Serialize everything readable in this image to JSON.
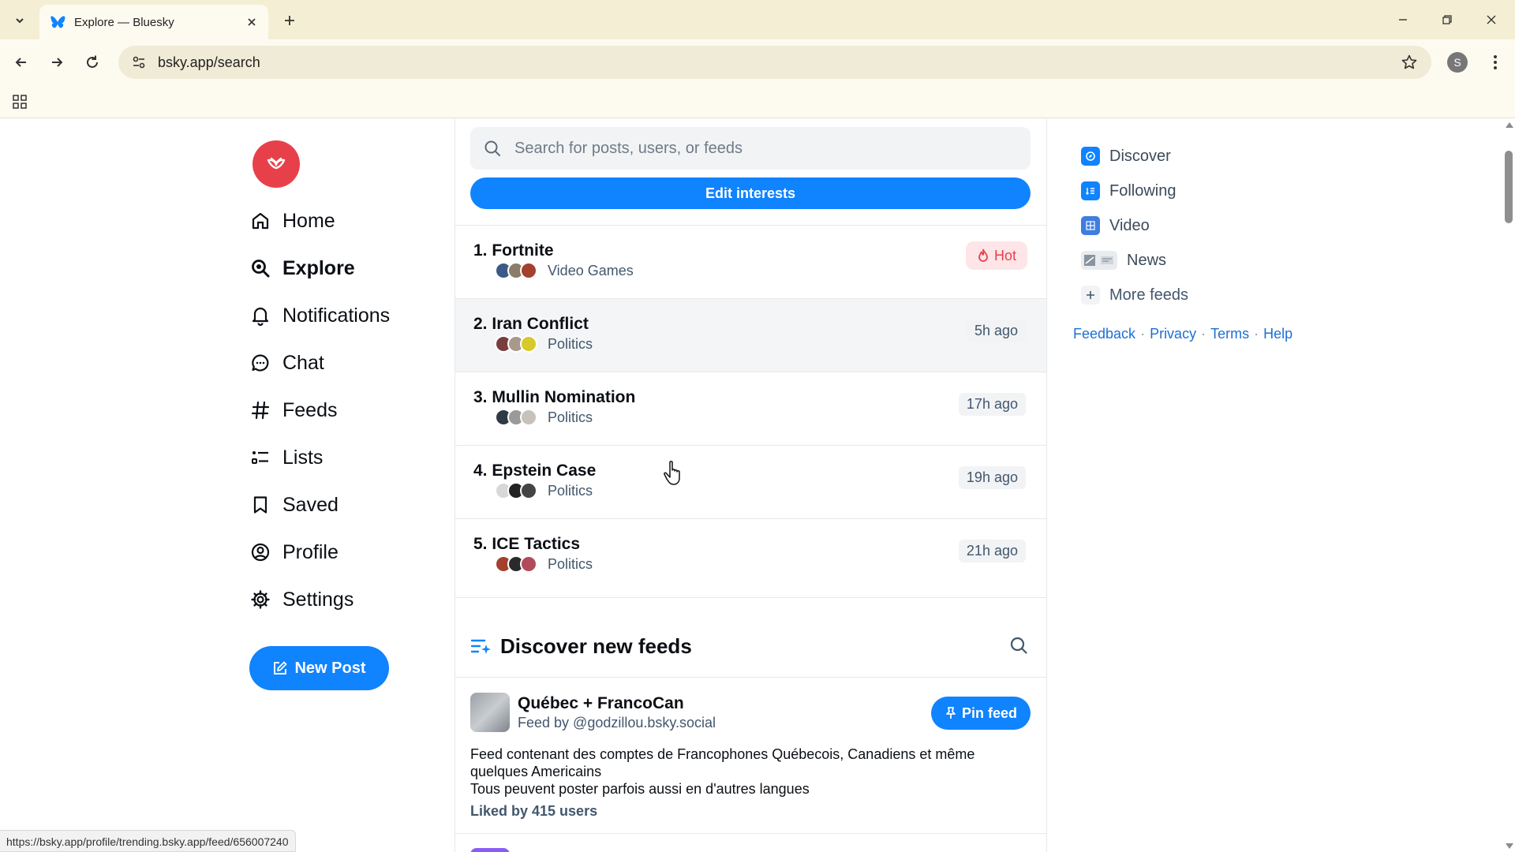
{
  "browser": {
    "tab_title": "Explore — Bluesky",
    "url": "bsky.app/search",
    "profile_initial": "S",
    "status_url": "https://bsky.app/profile/trending.bsky.app/feed/656007240"
  },
  "nav": {
    "items": [
      {
        "label": "Home",
        "icon": "home-icon"
      },
      {
        "label": "Explore",
        "icon": "search-icon"
      },
      {
        "label": "Notifications",
        "icon": "bell-icon"
      },
      {
        "label": "Chat",
        "icon": "chat-icon"
      },
      {
        "label": "Feeds",
        "icon": "hash-icon"
      },
      {
        "label": "Lists",
        "icon": "list-icon"
      },
      {
        "label": "Saved",
        "icon": "bookmark-icon"
      },
      {
        "label": "Profile",
        "icon": "profile-icon"
      },
      {
        "label": "Settings",
        "icon": "gear-icon"
      }
    ],
    "new_post_label": "New Post"
  },
  "search": {
    "placeholder": "Search for posts, users, or feeds"
  },
  "edit_interests_label": "Edit interests",
  "trending": [
    {
      "rank": "1.",
      "name": "Fortnite",
      "category": "Video Games",
      "badge": "Hot",
      "time": ""
    },
    {
      "rank": "2.",
      "name": "Iran Conflict",
      "category": "Politics",
      "badge": "",
      "time": "5h ago"
    },
    {
      "rank": "3.",
      "name": "Mullin Nomination",
      "category": "Politics",
      "badge": "",
      "time": "17h ago"
    },
    {
      "rank": "4.",
      "name": "Epstein Case",
      "category": "Politics",
      "badge": "",
      "time": "19h ago"
    },
    {
      "rank": "5.",
      "name": "ICE Tactics",
      "category": "Politics",
      "badge": "",
      "time": "21h ago"
    }
  ],
  "discover": {
    "title": "Discover new feeds",
    "feed": {
      "title": "Québec + FrancoCan",
      "by": "Feed by @godzillou.bsky.social",
      "pin_label": "Pin feed",
      "description_lines": [
        "Feed contenant des comptes de Francophones  Québecois, Canadiens et même quelques Americains",
        "Tous peuvent poster parfois aussi en d'autres langues"
      ],
      "liked": "Liked by 415 users"
    }
  },
  "right": {
    "feeds": [
      {
        "label": "Discover",
        "icon": "discover-icon"
      },
      {
        "label": "Following",
        "icon": "following-icon"
      },
      {
        "label": "Video",
        "icon": "video-icon"
      },
      {
        "label": "News",
        "icon": "news-icon"
      }
    ],
    "more_feeds": "More feeds",
    "footer": [
      "Feedback",
      "Privacy",
      "Terms",
      "Help"
    ]
  },
  "colors": {
    "accent": "#1083fe",
    "logo": "#e8404a",
    "hot_bg": "#fde5e8"
  }
}
